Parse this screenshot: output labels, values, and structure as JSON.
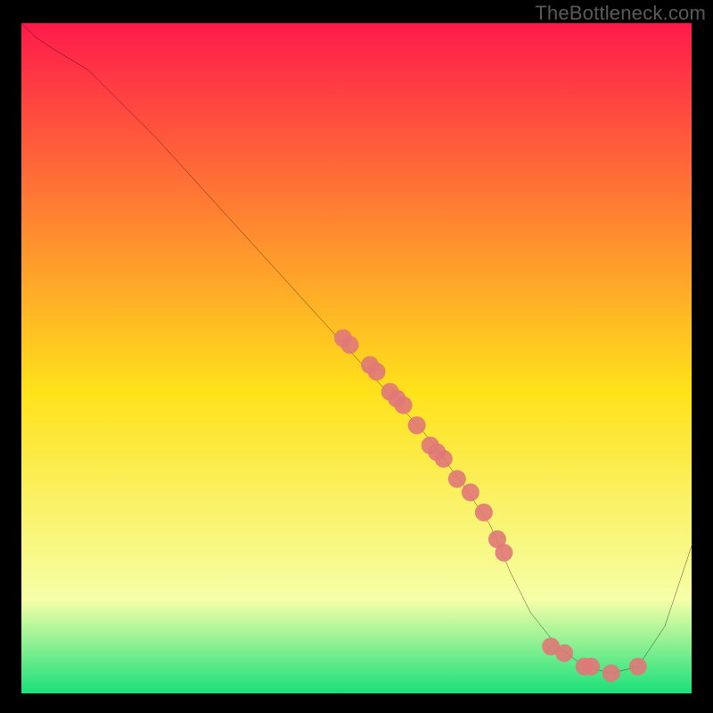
{
  "watermark": "TheBottleneck.com",
  "chart_data": {
    "type": "line",
    "title": "",
    "xlabel": "",
    "ylabel": "",
    "xlim": [
      0,
      100
    ],
    "ylim": [
      0,
      100
    ],
    "grid": false,
    "legend": false,
    "background_gradient": {
      "top_color": "#ff1a4b",
      "mid_color": "#ffe21a",
      "near_bottom_color": "#f6ffa8",
      "bottom_color": "#18e07a"
    },
    "series": [
      {
        "name": "curve",
        "style": "line",
        "color": "#000000",
        "x": [
          0,
          2,
          5,
          10,
          20,
          30,
          40,
          50,
          60,
          66,
          70,
          73,
          76,
          80,
          84,
          88,
          92,
          96,
          100
        ],
        "y": [
          100,
          98,
          96,
          93,
          83,
          72,
          61,
          50,
          39,
          31,
          25,
          18,
          12,
          7,
          4,
          3,
          4,
          10,
          22
        ]
      },
      {
        "name": "points-on-curve",
        "style": "scatter",
        "color": "#e07878",
        "marker_radius": 10,
        "x": [
          48,
          49,
          52,
          53,
          55,
          56,
          57,
          59,
          61,
          62,
          63,
          65,
          67,
          69,
          71,
          72,
          79,
          81,
          84,
          85,
          88,
          92
        ],
        "y": [
          53,
          52,
          49,
          48,
          45,
          44,
          43,
          40,
          37,
          36,
          35,
          32,
          30,
          27,
          23,
          21,
          7,
          6,
          4,
          4,
          3,
          4
        ]
      }
    ]
  }
}
